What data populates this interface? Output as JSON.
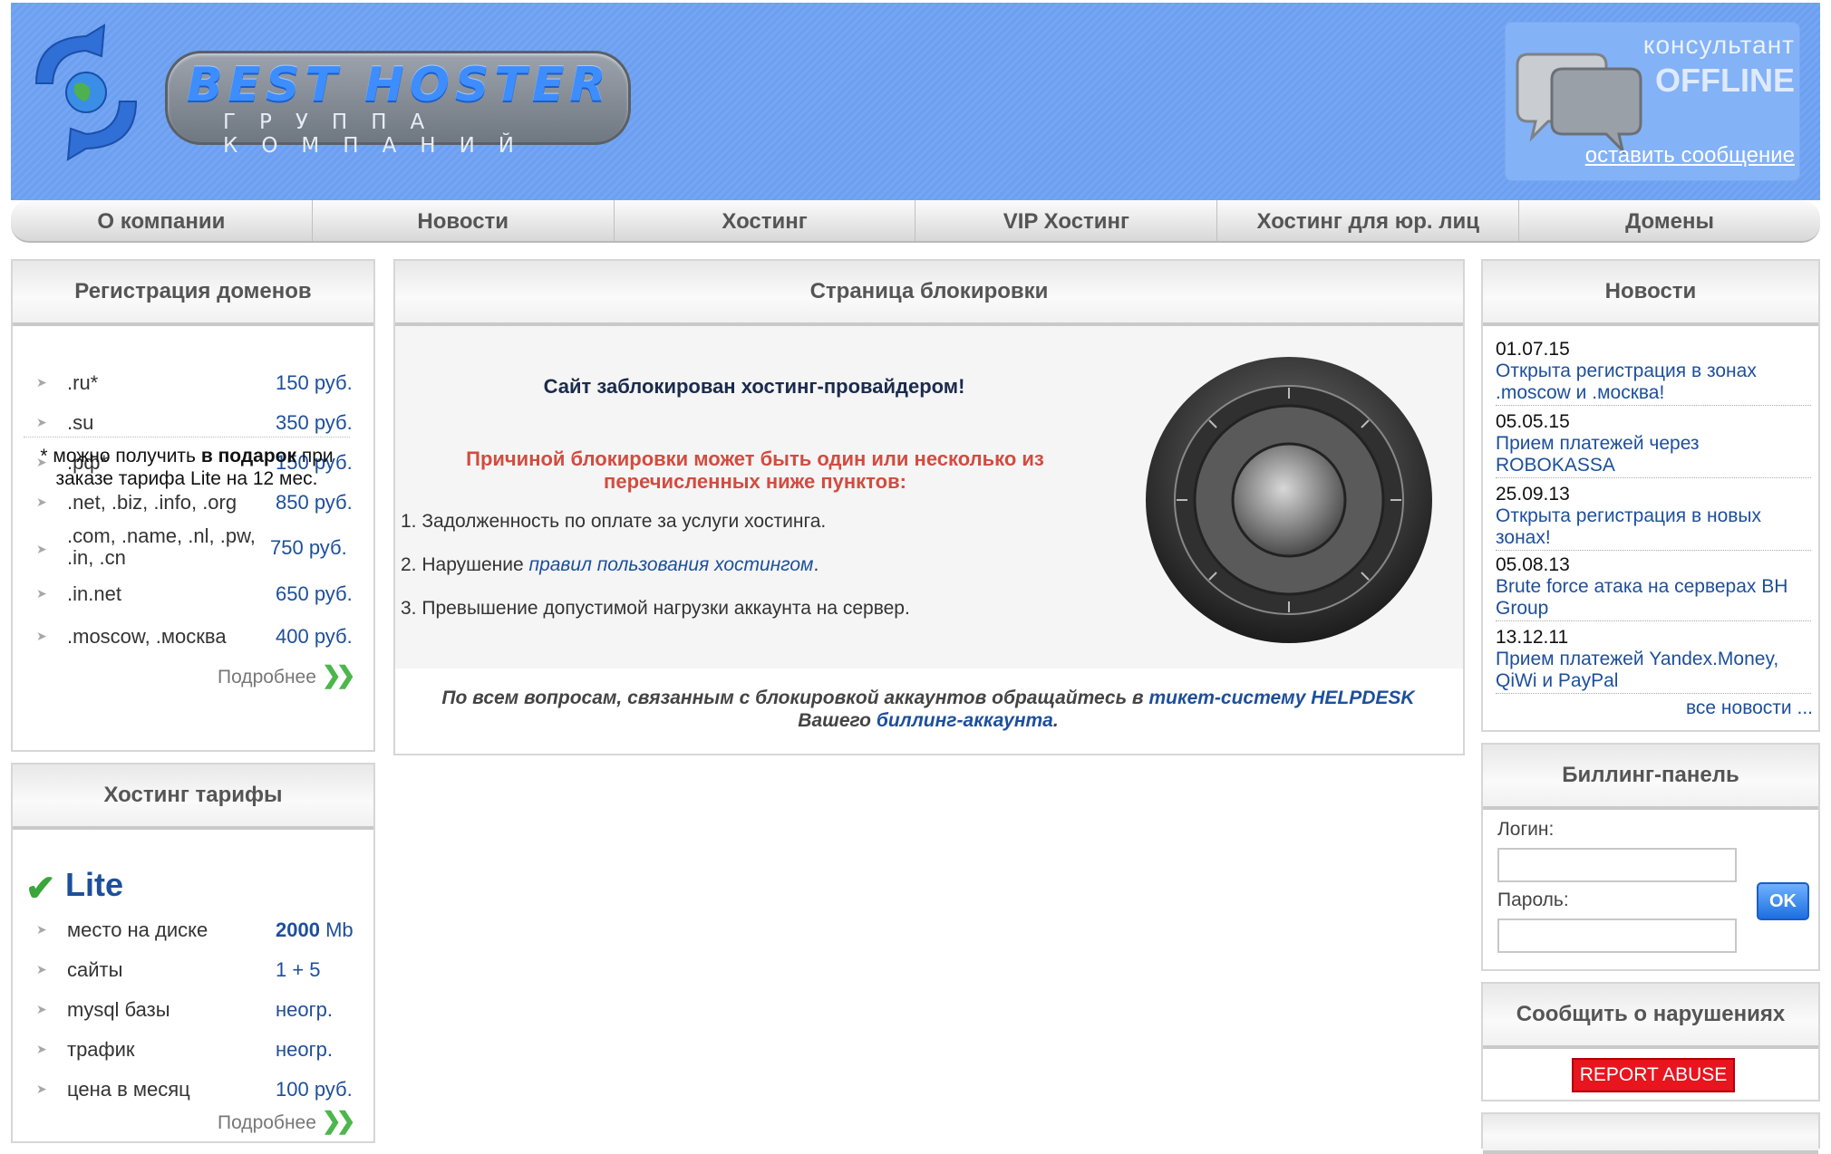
{
  "header": {
    "logo_name": "BEST HOSTER",
    "logo_sub": "ГРУППА КОМПАНИЙ",
    "consultant_title": "консультант",
    "consultant_status": "OFFLINE",
    "consultant_link": "оставить сообщение"
  },
  "nav": [
    "О компании",
    "Новости",
    "Хостинг",
    "VIP Хостинг",
    "Хостинг для юр. лиц",
    "Домены"
  ],
  "domains": {
    "title": "Регистрация доменов",
    "rows": [
      {
        "name": ".ru*",
        "price": "150 руб."
      },
      {
        "name": ".su",
        "price": "350 руб."
      },
      {
        "name": ".рф*",
        "price": "150 руб."
      },
      {
        "name": ".net, .biz, .info, .org",
        "price": "850 руб."
      },
      {
        "name": ".com, .name, .nl, .pw,",
        "name2": ".in, .cn",
        "price": "750 руб."
      },
      {
        "name": ".in.net",
        "price": "650 руб."
      },
      {
        "name": ".moscow, .москва",
        "price": "400 руб."
      }
    ],
    "more": "Подробнее",
    "gift_pre": "* можно получить ",
    "gift_bold": "в подарок",
    "gift_post": " при заказе тарифа Lite на 12 мес."
  },
  "tariffs": {
    "title": "Хостинг тарифы",
    "plan": "Lite",
    "rows": [
      {
        "name": "место на диске",
        "value_bold": "2000",
        "value_unit": " Mb"
      },
      {
        "name": "сайты",
        "value": "1 + 5"
      },
      {
        "name": "mysql базы",
        "value": "неогр."
      },
      {
        "name": "трафик",
        "value": "неогр."
      },
      {
        "name": "цена в месяц",
        "value": "100 руб."
      }
    ],
    "more": "Подробнее"
  },
  "center": {
    "title": "Страница блокировки",
    "blocked": "Сайт заблокирован хостинг-провайдером!",
    "reason": "Причиной блокировки может быть один или несколько из перечисленных ниже пунктов:",
    "item1": "1. Задолженность по оплате за услуги хостинга.",
    "item2_pre": "2. Нарушение ",
    "item2_link": "правил пользования хостингом",
    "item2_post": ".",
    "item3": "3. Превышение допустимой нагрузки аккаунта на сервер.",
    "contact_pre": "По всем вопросам, связанным с блокировкой аккаунтов обращайтесь в ",
    "contact_link1": "тикет-систему HELPDESK",
    "contact_mid": " Вашего ",
    "contact_link2": "биллинг-аккаунта",
    "contact_post": "."
  },
  "news": {
    "title": "Новости",
    "items": [
      {
        "date": "01.07.15",
        "text": "Открыта регистрация в зонах .moscow и .москва!"
      },
      {
        "date": "05.05.15",
        "text": "Прием платежей через ROBOKASSA"
      },
      {
        "date": "25.09.13",
        "text": "Открыта регистрация в новых зонах!"
      },
      {
        "date": "05.08.13",
        "text": "Brute force атака на серверах BH Group"
      },
      {
        "date": "13.12.11",
        "text": "Прием платежей Yandex.Money, QiWi и PayPal"
      }
    ],
    "all": "все новости ..."
  },
  "billing": {
    "title": "Биллинг-панель",
    "login_label": "Логин:",
    "password_label": "Пароль:",
    "ok": "OK"
  },
  "abuse": {
    "title": "Сообщить о нарушениях",
    "button": "REPORT ABUSE"
  },
  "colors": {
    "header_blue": "#74a6f3",
    "link": "#1d4f9b",
    "warning": "#d24c3f",
    "abuse_red": "#e8141e"
  }
}
